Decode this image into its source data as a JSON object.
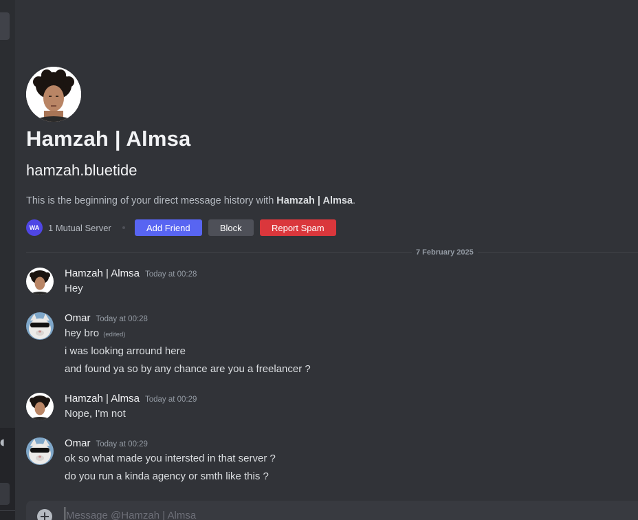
{
  "profile": {
    "display_name": "Hamzah | Almsa",
    "username": "hamzah.bluetide",
    "intro_prefix": "This is the beginning of your direct message history with ",
    "intro_name": "Hamzah | Almsa",
    "intro_suffix": ".",
    "mutual_server_icon": "WA",
    "mutual_servers": "1 Mutual Server",
    "buttons": {
      "add_friend": "Add Friend",
      "block": "Block",
      "report_spam": "Report Spam"
    }
  },
  "divider_date": "7 February 2025",
  "messages": [
    {
      "author": "Hamzah | Almsa",
      "time": "Today at 00:28",
      "avatar": "hamzah-avatar",
      "lines": [
        "Hey"
      ]
    },
    {
      "author": "Omar",
      "time": "Today at 00:28",
      "avatar": "omar-cat-avatar",
      "lines": [
        "hey bro",
        "i was looking arround here",
        "and found ya so by any chance are you a freelancer ?"
      ],
      "edited_label": "(edited)"
    },
    {
      "author": "Hamzah | Almsa",
      "time": "Today at 00:29",
      "avatar": "hamzah-avatar",
      "lines": [
        "Nope, I'm not"
      ]
    },
    {
      "author": "Omar",
      "time": "Today at 00:29",
      "avatar": "omar-cat-avatar",
      "lines": [
        "ok so what made you intersted in that server ?",
        "do you run a kinda agency or smth like this ?"
      ]
    }
  ],
  "composer": {
    "placeholder": "Message @Hamzah | Almsa"
  },
  "colors": {
    "background": "#313338",
    "add_friend": "#5865f2",
    "block": "#4e5058",
    "report_spam": "#da373c"
  }
}
